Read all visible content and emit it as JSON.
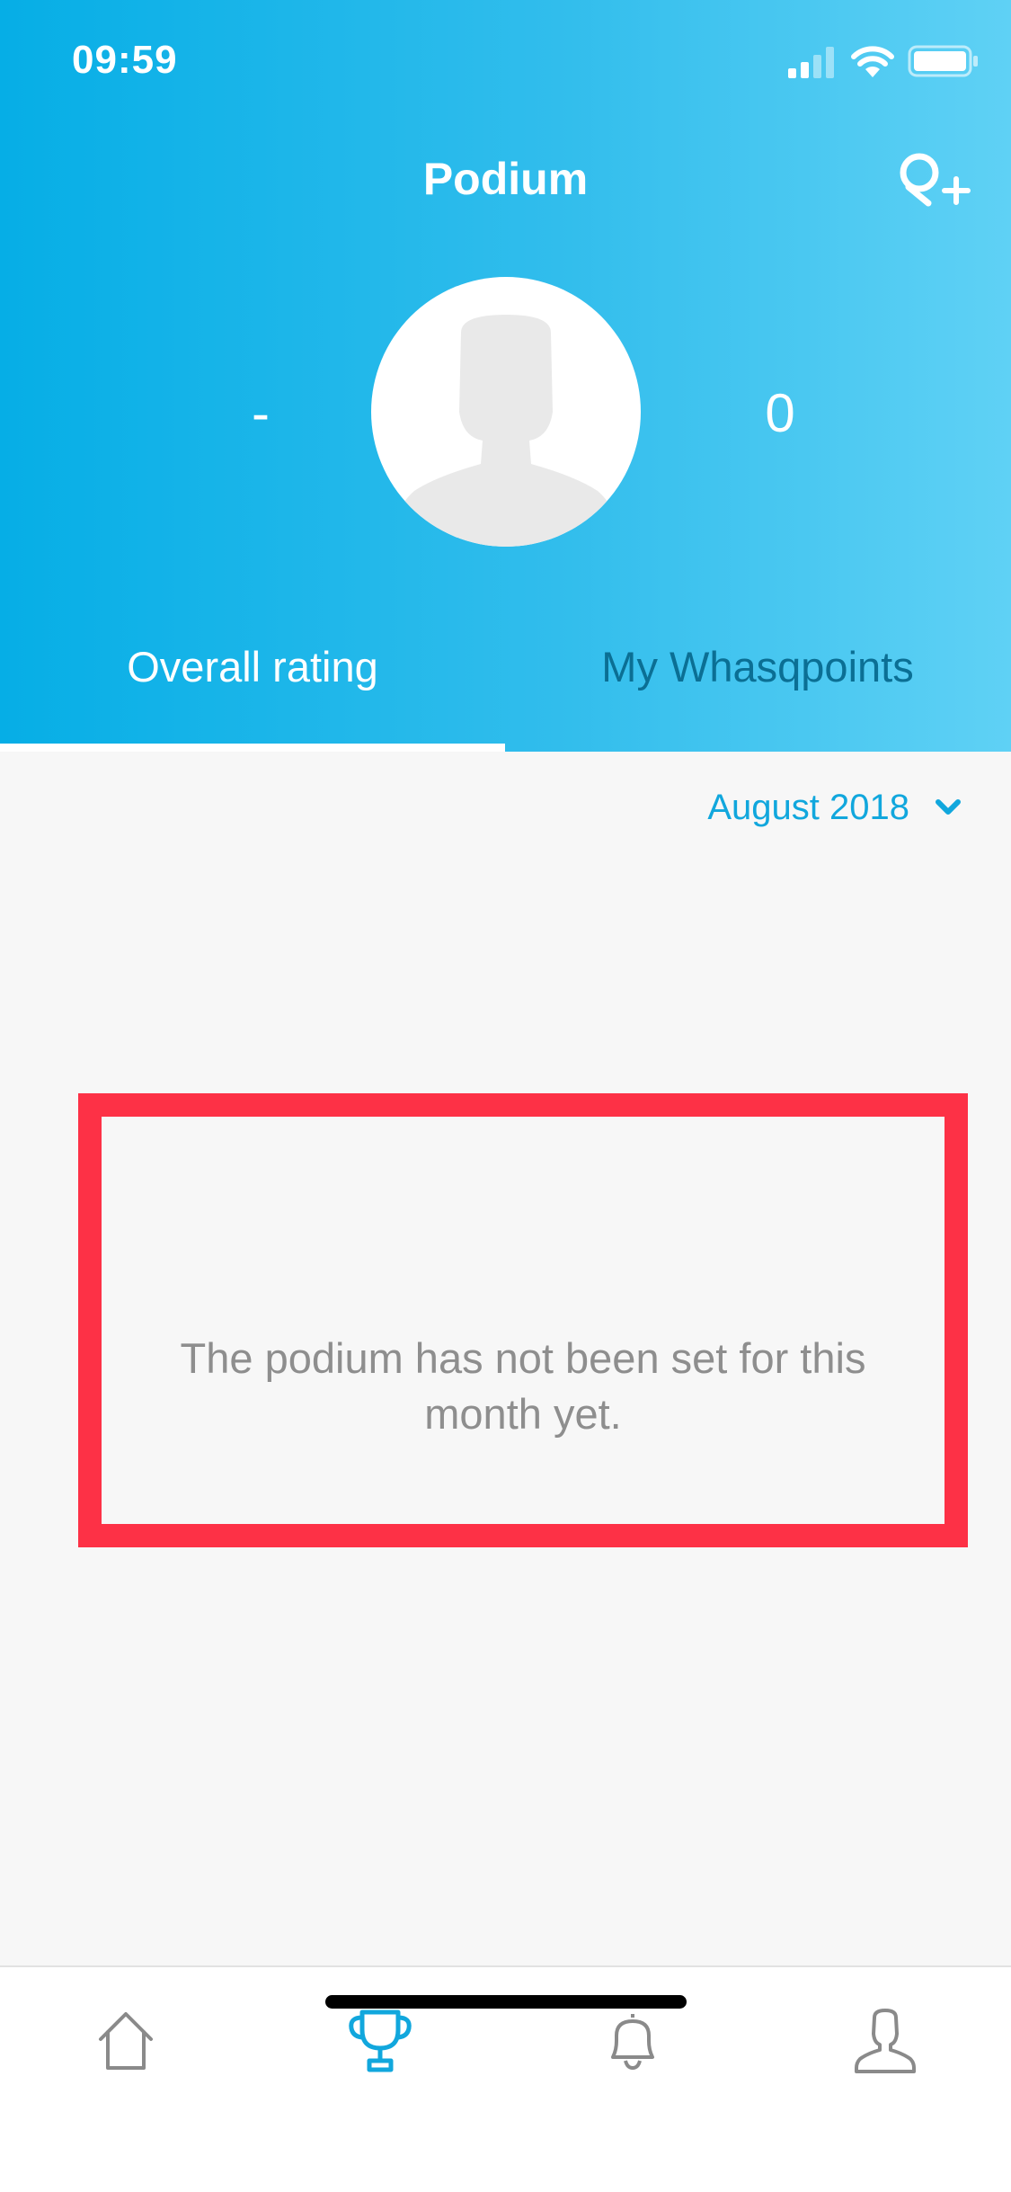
{
  "status_bar": {
    "time": "09:59",
    "icons": [
      "signal-icon",
      "wifi-icon",
      "battery-icon"
    ]
  },
  "nav": {
    "title": "Podium",
    "action_icon": "add-user-icon"
  },
  "profile": {
    "rank": "-",
    "points": "0",
    "avatar_icon": "person-silhouette-icon"
  },
  "tabs": [
    {
      "label": "Overall rating",
      "selected": true
    },
    {
      "label": "My Whasqpoints",
      "selected": false
    }
  ],
  "month_selector": {
    "label": "August 2018",
    "icon": "chevron-down-icon"
  },
  "empty_state": {
    "message": "The podium has not been set for this month yet."
  },
  "tab_bar": {
    "items": [
      {
        "icon": "home-icon",
        "selected": false
      },
      {
        "icon": "trophy-icon",
        "selected": true
      },
      {
        "icon": "bell-icon",
        "selected": false
      },
      {
        "icon": "profile-icon",
        "selected": false
      }
    ]
  },
  "colors": {
    "header_gradient_start": "#06aee6",
    "header_gradient_end": "#5fd1f5",
    "accent": "#11a7dd",
    "highlight_box": "#fd3146",
    "muted_text": "#8e8e8e",
    "inactive_tab_text": "#0b6f94"
  }
}
